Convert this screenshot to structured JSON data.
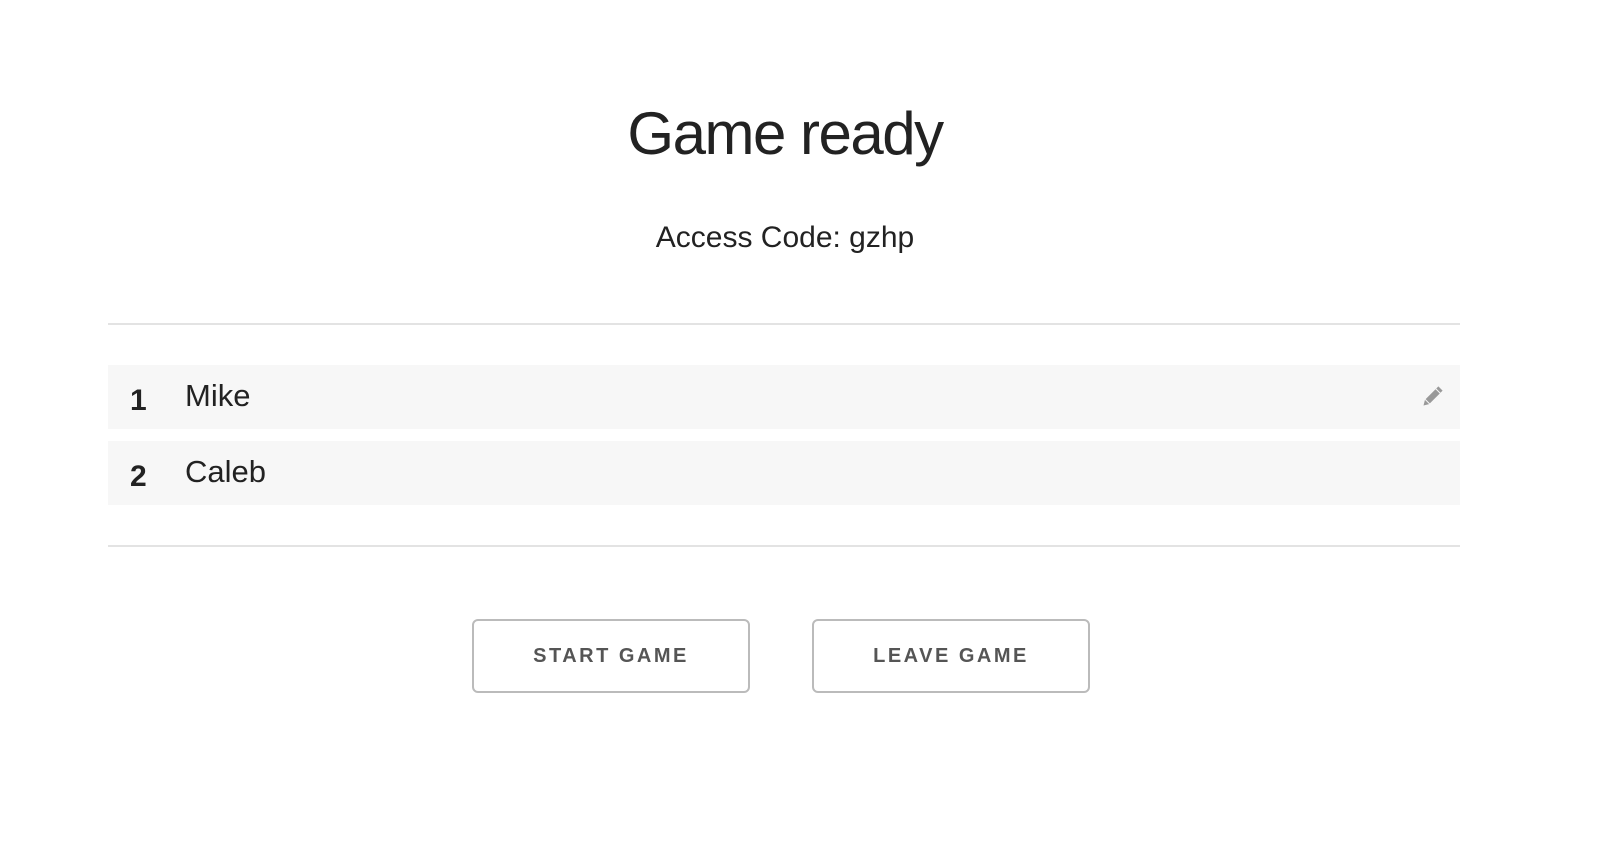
{
  "header": {
    "title": "Game ready",
    "access_code_label": "Access Code: gzhp"
  },
  "players": [
    {
      "number": "1",
      "name": "Mike",
      "editable": true
    },
    {
      "number": "2",
      "name": "Caleb",
      "editable": false
    }
  ],
  "icons": {
    "edit": "pencil-icon"
  },
  "actions": {
    "start_label": "START GAME",
    "leave_label": "LEAVE GAME"
  },
  "colors": {
    "text": "#222222",
    "row_background": "#f7f7f7",
    "divider": "#e3e3e3",
    "button_border": "#bbbbbb",
    "button_text": "#555555",
    "icon": "#999999"
  }
}
